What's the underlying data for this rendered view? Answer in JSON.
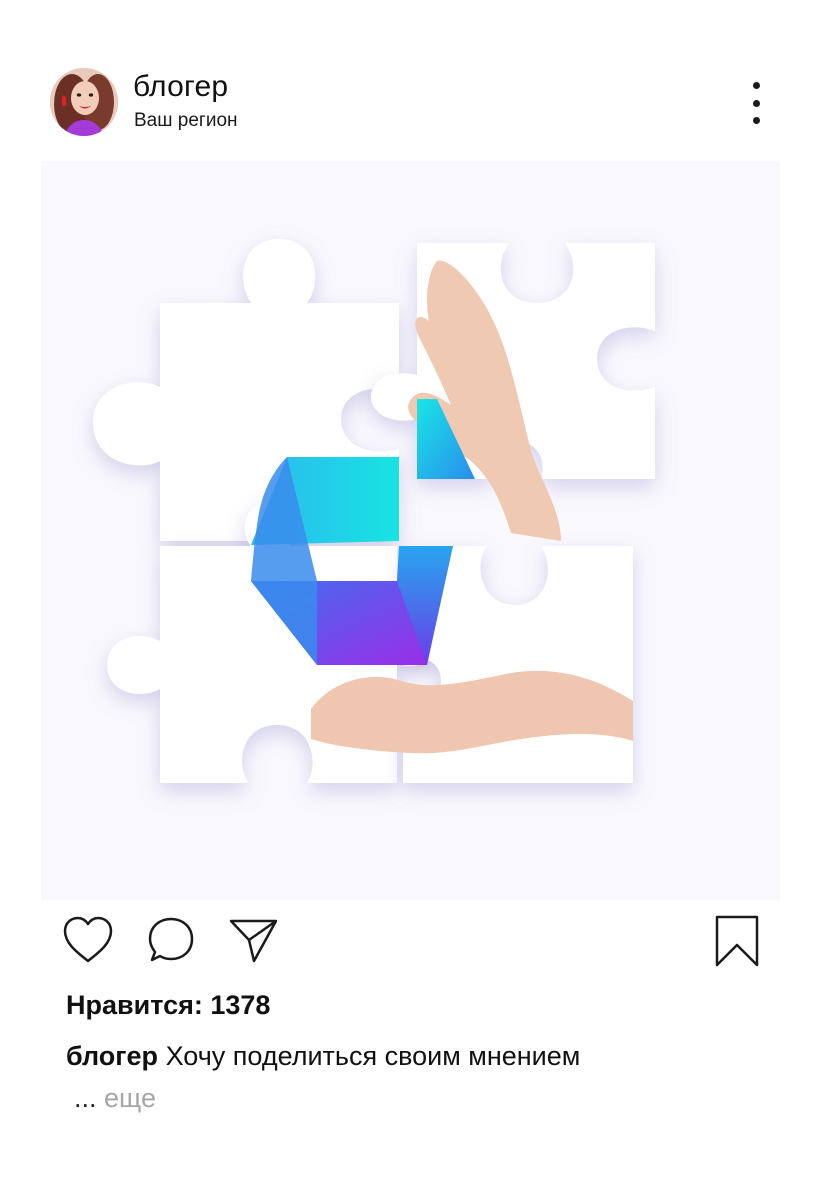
{
  "header": {
    "username": "блогер",
    "region": "Ваш регион",
    "avatar_icon": "user-avatar",
    "menu_icon": "more-vertical-icon"
  },
  "actions": {
    "like_icon": "heart-icon",
    "comment_icon": "comment-bubble-icon",
    "share_icon": "paper-plane-icon",
    "save_icon": "bookmark-icon"
  },
  "likes": {
    "label": "Нравится:",
    "count": "1378"
  },
  "caption": {
    "username": "блогер",
    "text": "Хочу поделиться своим мнением",
    "ellipsis": "...",
    "more_label": "еще"
  },
  "colors": {
    "cube_top": "#1de0e6",
    "cube_side": "#2a7de8",
    "cube_front": "#8b3be8",
    "background": "#f9f8fd",
    "muted_text": "#a6a6a6"
  }
}
